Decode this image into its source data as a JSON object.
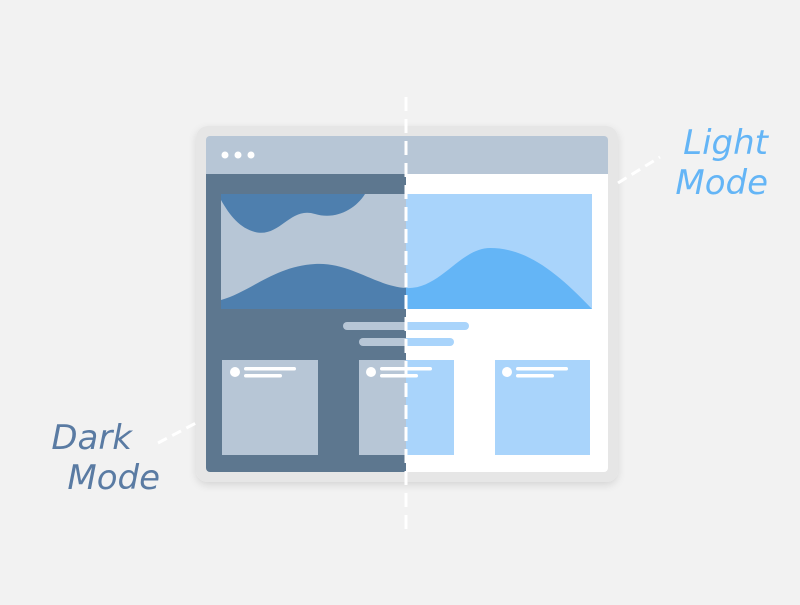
{
  "labels": {
    "light": [
      "Light",
      "Mode"
    ],
    "dark": [
      "Dark",
      "Mode"
    ]
  },
  "colors": {
    "background": "#f2f2f2",
    "frame": "#e6e6e6",
    "titlebar": "#b7c6d6",
    "dark_panel": "#5d778f",
    "dark_hero": "#b7c6d6",
    "dark_wave": "#4e7fae",
    "light_panel": "#ffffff",
    "light_hero": "#a9d4fb",
    "light_wave": "#64b5f6",
    "dark_label": "#5a7ba3",
    "light_label": "#64b5f6",
    "divider": "#ffffff"
  },
  "window": {
    "traffic_dots": 3,
    "cards": 3
  }
}
